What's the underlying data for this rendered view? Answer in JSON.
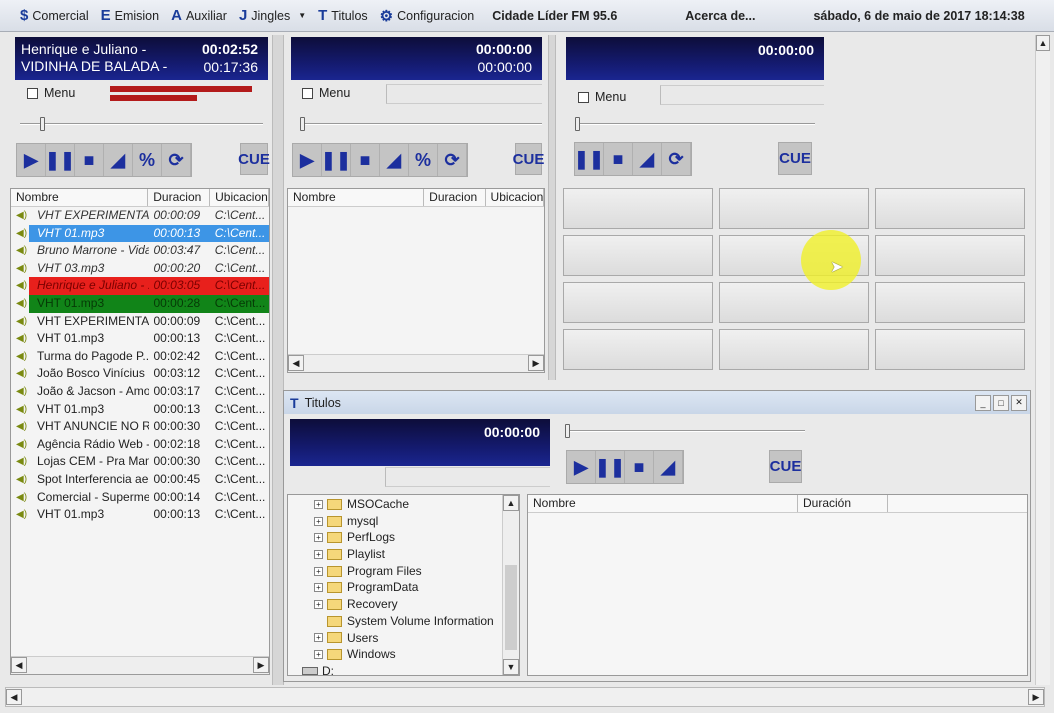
{
  "menubar": {
    "items": [
      {
        "icon": "$",
        "label": "Comercial"
      },
      {
        "icon": "E",
        "label": "Emision"
      },
      {
        "icon": "A",
        "label": "Auxiliar"
      },
      {
        "icon": "J",
        "label": "Jingles"
      },
      {
        "icon": "T",
        "label": "Titulos"
      },
      {
        "icon": "⚙",
        "label": "Configuracion"
      }
    ],
    "station": "Cidade Líder FM 95.6",
    "about": "Acerca de...",
    "datetime": "sábado, 6 de maio de 2017 18:14:38"
  },
  "player1": {
    "line1": "Henrique e Juliano -",
    "line2": "VIDINHA DE BALADA -",
    "elapsed": "00:02:52",
    "total": "00:17:36",
    "menu": "Menu",
    "cue": "CUE",
    "vu_left": 0.9,
    "vu_right": 0.55
  },
  "player2": {
    "elapsed": "00:00:00",
    "total": "00:00:00",
    "menu": "Menu",
    "cue": "CUE"
  },
  "player3": {
    "time": "00:00:00",
    "menu": "Menu",
    "cue": "CUE"
  },
  "playlist": {
    "columns": [
      "Nombre",
      "Duracion",
      "Ubicacion"
    ],
    "rows": [
      {
        "name": "VHT EXPERIMENTA...",
        "dur": "00:00:09",
        "loc": "C:\\Cent...",
        "state": "played"
      },
      {
        "name": "VHT 01.mp3",
        "dur": "00:00:13",
        "loc": "C:\\Cent...",
        "state": "selected"
      },
      {
        "name": "Bruno  Marrone - Vida...",
        "dur": "00:03:47",
        "loc": "C:\\Cent...",
        "state": "played"
      },
      {
        "name": "VHT 03.mp3",
        "dur": "00:00:20",
        "loc": "C:\\Cent...",
        "state": "played"
      },
      {
        "name": "Henrique e Juliano - ...",
        "dur": "00:03:05",
        "loc": "C:\\Cent...",
        "state": "playing"
      },
      {
        "name": "VHT 01.mp3",
        "dur": "00:00:28",
        "loc": "C:\\Cent...",
        "state": "next"
      },
      {
        "name": "VHT EXPERIMENTA...",
        "dur": "00:00:09",
        "loc": "C:\\Cent...",
        "state": ""
      },
      {
        "name": "VHT 01.mp3",
        "dur": "00:00:13",
        "loc": "C:\\Cent...",
        "state": ""
      },
      {
        "name": "Turma do Pagode  P...",
        "dur": "00:02:42",
        "loc": "C:\\Cent...",
        "state": ""
      },
      {
        "name": "João Bosco  Vinícius ...",
        "dur": "00:03:12",
        "loc": "C:\\Cent...",
        "state": ""
      },
      {
        "name": "João & Jacson - Amor...",
        "dur": "00:03:17",
        "loc": "C:\\Cent...",
        "state": ""
      },
      {
        "name": "VHT 01.mp3",
        "dur": "00:00:13",
        "loc": "C:\\Cent...",
        "state": ""
      },
      {
        "name": "VHT ANUNCIE NO R...",
        "dur": "00:00:30",
        "loc": "C:\\Cent...",
        "state": ""
      },
      {
        "name": "Agência Rádio Web -...",
        "dur": "00:02:18",
        "loc": "C:\\Cent...",
        "state": ""
      },
      {
        "name": "Lojas CEM - Pra Mam...",
        "dur": "00:00:30",
        "loc": "C:\\Cent...",
        "state": ""
      },
      {
        "name": "Spot Interferencia aer...",
        "dur": "00:00:45",
        "loc": "C:\\Cent...",
        "state": ""
      },
      {
        "name": "Comercial - Supermer...",
        "dur": "00:00:14",
        "loc": "C:\\Cent...",
        "state": ""
      },
      {
        "name": "VHT 01.mp3",
        "dur": "00:00:13",
        "loc": "C:\\Cent...",
        "state": ""
      }
    ]
  },
  "playlist2": {
    "columns": [
      "Nombre",
      "Duracion",
      "Ubicacion"
    ]
  },
  "titulos": {
    "title": "Titulos",
    "time": "00:00:00",
    "cue": "CUE",
    "columns": [
      "Nombre",
      "Duración"
    ],
    "tree": [
      {
        "label": "MSOCache",
        "exp": true
      },
      {
        "label": "mysql",
        "exp": true
      },
      {
        "label": "PerfLogs",
        "exp": true
      },
      {
        "label": "Playlist",
        "exp": true
      },
      {
        "label": "Program Files",
        "exp": true
      },
      {
        "label": "ProgramData",
        "exp": true
      },
      {
        "label": "Recovery",
        "exp": true
      },
      {
        "label": "System Volume Information",
        "exp": false
      },
      {
        "label": "Users",
        "exp": true
      },
      {
        "label": "Windows",
        "exp": true
      }
    ],
    "drive": "D:"
  },
  "colors": {
    "selected": "#3d95e6",
    "playing": "#e8201c",
    "next": "#118418",
    "display": "#141a6e",
    "accent": "#1c2f9e"
  }
}
